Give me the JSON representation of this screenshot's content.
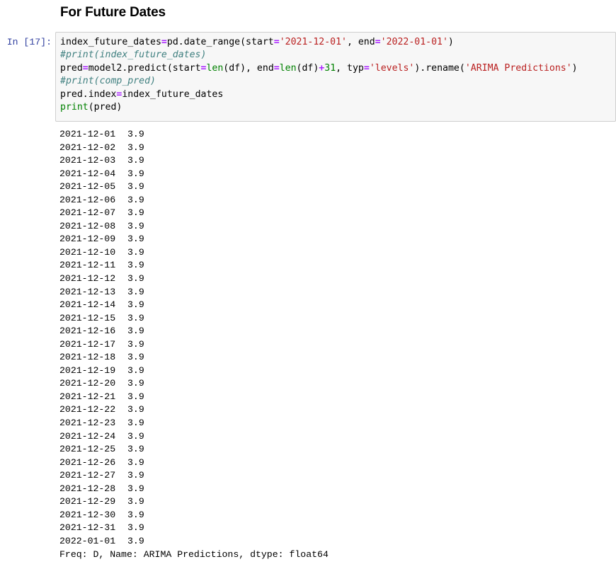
{
  "markdown": {
    "heading": "For Future Dates"
  },
  "code_cell": {
    "prompt": "In [17]:",
    "lines": [
      {
        "tokens": [
          {
            "t": "plain",
            "v": "index_future_dates"
          },
          {
            "t": "op",
            "v": "="
          },
          {
            "t": "plain",
            "v": "pd.date_range(start"
          },
          {
            "t": "op",
            "v": "="
          },
          {
            "t": "str",
            "v": "'2021-12-01'"
          },
          {
            "t": "plain",
            "v": ", end"
          },
          {
            "t": "op",
            "v": "="
          },
          {
            "t": "str",
            "v": "'2022-01-01'"
          },
          {
            "t": "plain",
            "v": ")"
          }
        ]
      },
      {
        "tokens": [
          {
            "t": "com",
            "v": "#print(index_future_dates)"
          }
        ]
      },
      {
        "tokens": [
          {
            "t": "plain",
            "v": "pred"
          },
          {
            "t": "op",
            "v": "="
          },
          {
            "t": "plain",
            "v": "model2.predict(start"
          },
          {
            "t": "op",
            "v": "="
          },
          {
            "t": "bi",
            "v": "len"
          },
          {
            "t": "plain",
            "v": "(df), end"
          },
          {
            "t": "op",
            "v": "="
          },
          {
            "t": "bi",
            "v": "len"
          },
          {
            "t": "plain",
            "v": "(df)"
          },
          {
            "t": "op",
            "v": "+"
          },
          {
            "t": "num",
            "v": "31"
          },
          {
            "t": "plain",
            "v": ", typ"
          },
          {
            "t": "op",
            "v": "="
          },
          {
            "t": "str",
            "v": "'levels'"
          },
          {
            "t": "plain",
            "v": ").rename("
          },
          {
            "t": "str",
            "v": "'ARIMA Predictions'"
          },
          {
            "t": "plain",
            "v": ")"
          }
        ]
      },
      {
        "tokens": [
          {
            "t": "com",
            "v": "#print(comp_pred)"
          }
        ]
      },
      {
        "tokens": [
          {
            "t": "plain",
            "v": "pred.index"
          },
          {
            "t": "op",
            "v": "="
          },
          {
            "t": "plain",
            "v": "index_future_dates"
          }
        ]
      },
      {
        "tokens": [
          {
            "t": "bi",
            "v": "print"
          },
          {
            "t": "plain",
            "v": "(pred)"
          }
        ]
      }
    ]
  },
  "output": {
    "rows": [
      {
        "date": "2021-12-01",
        "value": "3.9"
      },
      {
        "date": "2021-12-02",
        "value": "3.9"
      },
      {
        "date": "2021-12-03",
        "value": "3.9"
      },
      {
        "date": "2021-12-04",
        "value": "3.9"
      },
      {
        "date": "2021-12-05",
        "value": "3.9"
      },
      {
        "date": "2021-12-06",
        "value": "3.9"
      },
      {
        "date": "2021-12-07",
        "value": "3.9"
      },
      {
        "date": "2021-12-08",
        "value": "3.9"
      },
      {
        "date": "2021-12-09",
        "value": "3.9"
      },
      {
        "date": "2021-12-10",
        "value": "3.9"
      },
      {
        "date": "2021-12-11",
        "value": "3.9"
      },
      {
        "date": "2021-12-12",
        "value": "3.9"
      },
      {
        "date": "2021-12-13",
        "value": "3.9"
      },
      {
        "date": "2021-12-14",
        "value": "3.9"
      },
      {
        "date": "2021-12-15",
        "value": "3.9"
      },
      {
        "date": "2021-12-16",
        "value": "3.9"
      },
      {
        "date": "2021-12-17",
        "value": "3.9"
      },
      {
        "date": "2021-12-18",
        "value": "3.9"
      },
      {
        "date": "2021-12-19",
        "value": "3.9"
      },
      {
        "date": "2021-12-20",
        "value": "3.9"
      },
      {
        "date": "2021-12-21",
        "value": "3.9"
      },
      {
        "date": "2021-12-22",
        "value": "3.9"
      },
      {
        "date": "2021-12-23",
        "value": "3.9"
      },
      {
        "date": "2021-12-24",
        "value": "3.9"
      },
      {
        "date": "2021-12-25",
        "value": "3.9"
      },
      {
        "date": "2021-12-26",
        "value": "3.9"
      },
      {
        "date": "2021-12-27",
        "value": "3.9"
      },
      {
        "date": "2021-12-28",
        "value": "3.9"
      },
      {
        "date": "2021-12-29",
        "value": "3.9"
      },
      {
        "date": "2021-12-30",
        "value": "3.9"
      },
      {
        "date": "2021-12-31",
        "value": "3.9"
      },
      {
        "date": "2022-01-01",
        "value": "3.9"
      }
    ],
    "footer": "Freq: D, Name: ARIMA Predictions, dtype: float64"
  },
  "colors": {
    "prompt": "#303F9F",
    "string": "#BA2121",
    "comment": "#408080",
    "operator": "#AA22FF",
    "builtin": "#008000",
    "number": "#008000",
    "cell_background": "#f7f7f7",
    "cell_border": "#cfcfcf"
  }
}
